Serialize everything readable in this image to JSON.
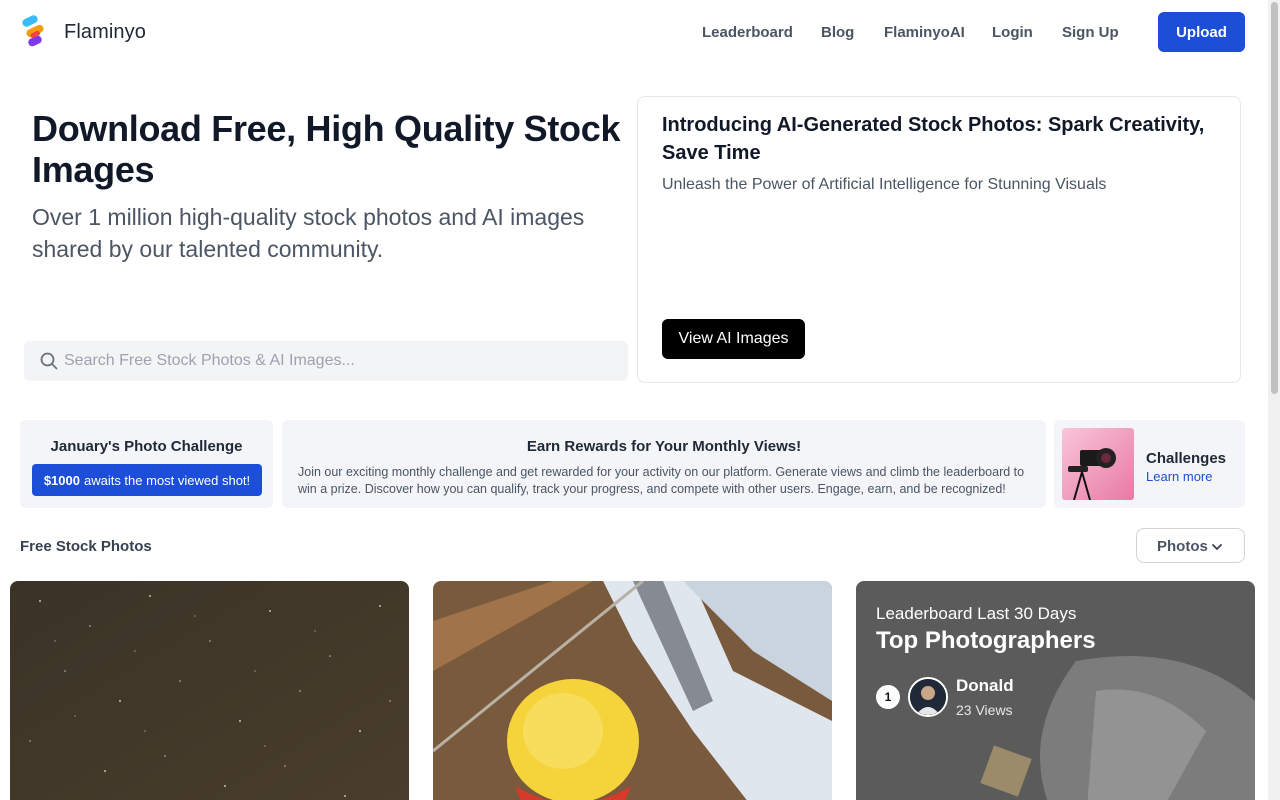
{
  "header": {
    "brand": "Flaminyo",
    "nav": [
      "Leaderboard",
      "Blog",
      "FlaminyoAI",
      "Login",
      "Sign Up"
    ],
    "upload_label": "Upload",
    "accent_color": "#1d4ed8"
  },
  "hero": {
    "title": "Download Free, High Quality Stock Images",
    "subtitle": "Over 1 million high-quality stock photos and AI images shared by our talented community.",
    "search_placeholder": "Search Free Stock Photos & AI Images...",
    "search_icon": "search-icon"
  },
  "ai_card": {
    "title": "Introducing AI-Generated Stock Photos: Spark Creativity, Save Time",
    "subtitle": "Unleash the Power of Artificial Intelligence for Stunning Visuals",
    "button_label": "View AI Images"
  },
  "challenge": {
    "title": "January's Photo Challenge",
    "amount": "$1000",
    "badge_text": "awaits the most viewed shot!"
  },
  "rewards": {
    "title": "Earn Rewards for Your Monthly Views!",
    "text": "Join our exciting monthly challenge and get rewarded for your activity on our platform. Generate views and climb the leaderboard to win a prize. Discover how you can qualify, track your progress, and compete with other users. Engage, earn, and be recognized!"
  },
  "challenges_card": {
    "title": "Challenges",
    "link": "Learn more"
  },
  "section": {
    "label": "Free Stock Photos",
    "filter_label": "Photos",
    "filter_icon": "chevron-down-icon"
  },
  "leaderboard": {
    "subtitle": "Leaderboard Last 30 Days",
    "title": "Top Photographers",
    "entries": [
      {
        "rank": "1",
        "name": "Donald",
        "views": "23 Views"
      }
    ]
  }
}
